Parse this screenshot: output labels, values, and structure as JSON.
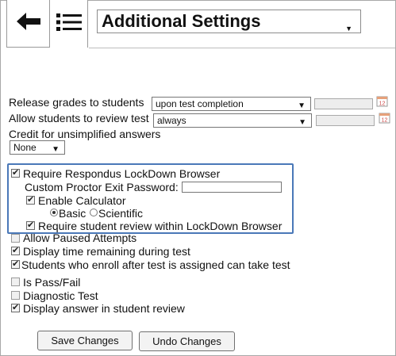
{
  "header": {
    "back_icon": "arrow-left-icon",
    "menu_icon": "list-icon",
    "title": "Additional Settings"
  },
  "settings": {
    "release_grades": {
      "label": "Release grades to students",
      "value": "upon test completion"
    },
    "allow_review": {
      "label": "Allow students to review test",
      "value": "always"
    },
    "credit": {
      "label": "Credit for unsimplified answers",
      "value": "None"
    }
  },
  "lockdown": {
    "require_label": "Require Respondus LockDown Browser",
    "password_label": "Custom Proctor Exit Password:",
    "password_value": "",
    "calculator_label": "Enable Calculator",
    "basic_label": "Basic",
    "scientific_label": "Scientific",
    "review_label": "Require student review within LockDown Browser"
  },
  "options": {
    "paused": "Allow Paused Attempts",
    "display_time": "Display time remaining during test",
    "late_enroll": "Students who enroll after test is assigned can take test",
    "pass_fail": "Is Pass/Fail",
    "diagnostic": "Diagnostic Test",
    "display_answer": "Display answer in student review"
  },
  "buttons": {
    "save": "Save Changes",
    "undo": "Undo Changes"
  },
  "colors": {
    "highlight": "#4a78b8"
  }
}
